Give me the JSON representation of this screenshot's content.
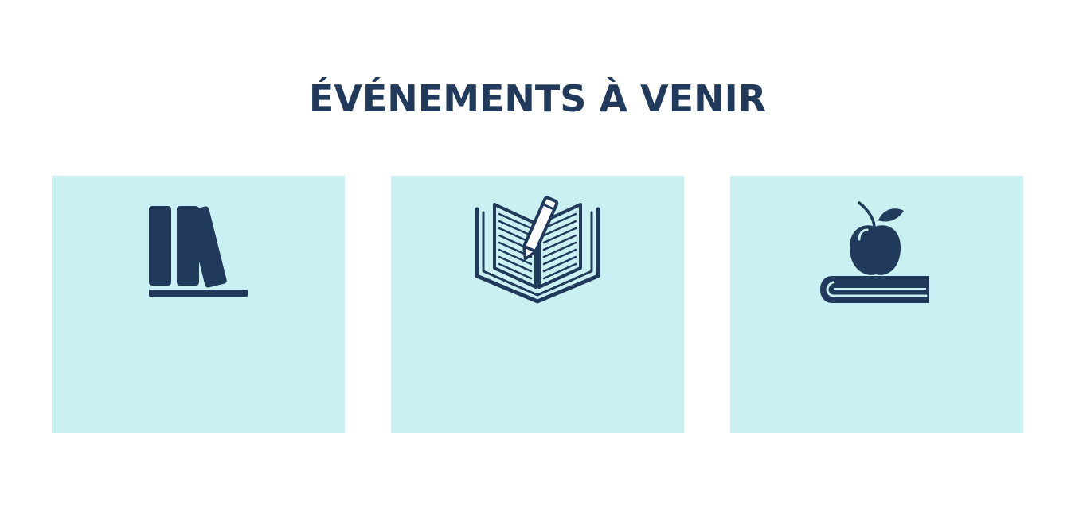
{
  "events": {
    "title": "ÉVÉNEMENTS À VENIR",
    "cards": [
      {
        "icon": "books-on-shelf-icon"
      },
      {
        "icon": "open-book-with-pen-icon"
      },
      {
        "icon": "apple-on-book-icon"
      }
    ]
  },
  "colors": {
    "title": "#213a5c",
    "icon": "#213a5c",
    "card_background": "#cbf0f1",
    "page_background": "#ffffff"
  }
}
